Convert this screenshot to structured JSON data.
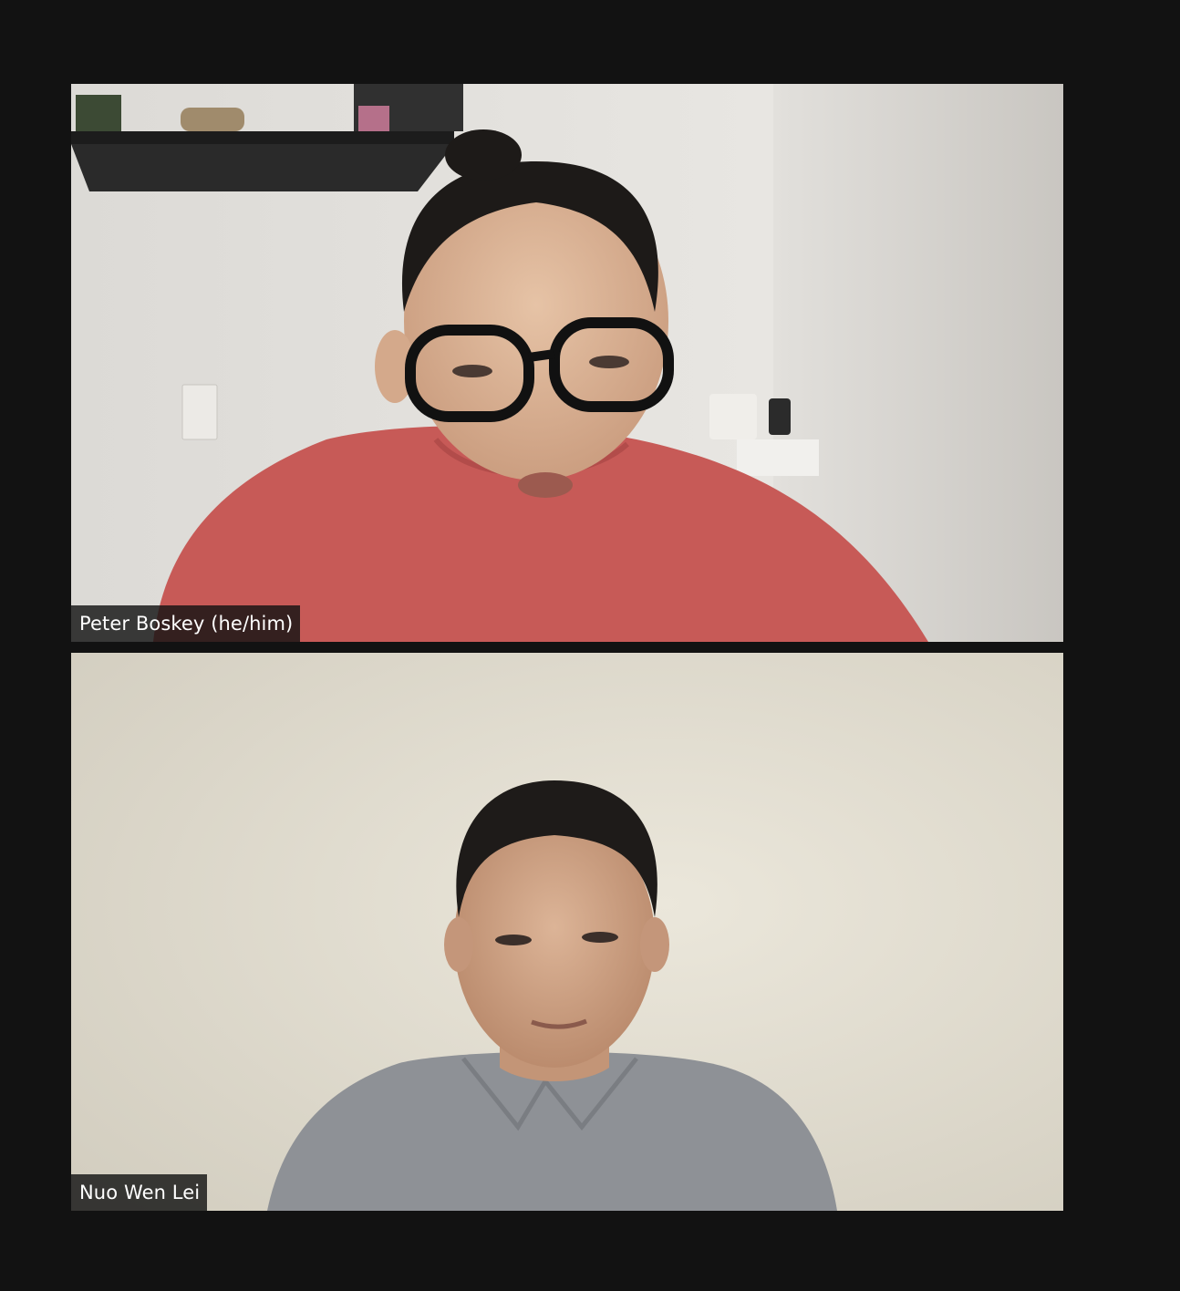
{
  "app": {
    "view": "gallery"
  },
  "participants": [
    {
      "name": "Peter Boskey (he/him)",
      "video": "on",
      "shirt_color": "#c75a57",
      "wall_color": "#e4e2dd"
    },
    {
      "name": "Nuo Wen Lei",
      "video": "on",
      "shirt_color": "#8e9196",
      "wall_color": "#e6e2d6"
    }
  ],
  "colors": {
    "background": "#121212",
    "name_tag_bg": "#141414",
    "name_tag_text": "#ffffff"
  }
}
